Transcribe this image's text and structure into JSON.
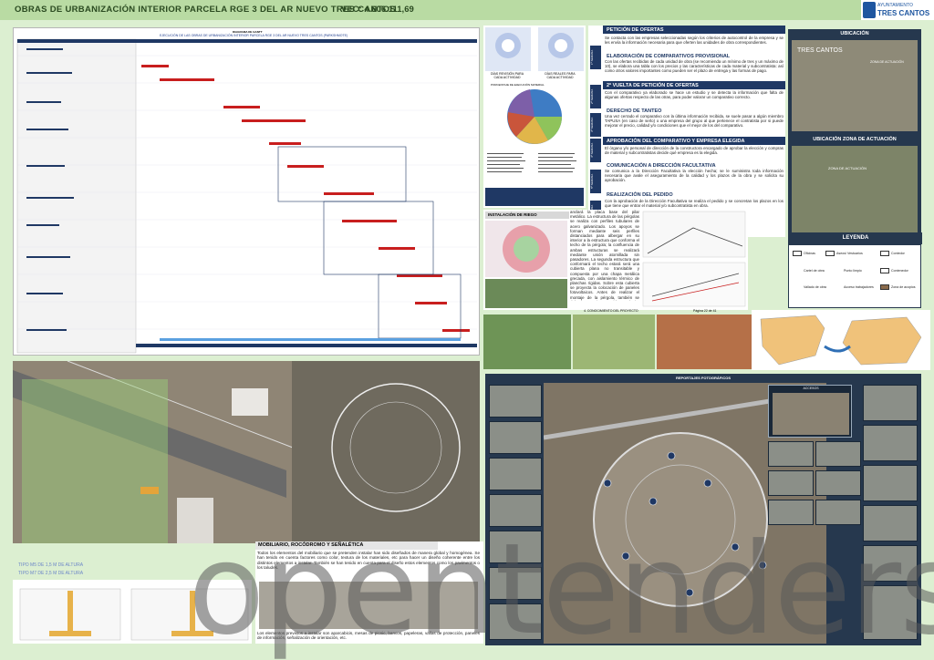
{
  "header": {
    "title": "OBRAS DE URBANIZACIÓN INTERIOR PARCELA RGE 3 DEL AR NUEVO TRES CANTOS",
    "version": "VEC: 4.606.111,69",
    "logo_line1": "AYUNTAMIENTO",
    "logo_line2": "TRES CANTOS"
  },
  "gantt": {
    "title_small": "DIAGRAMA DE GANTT",
    "title": "EJECUCIÓN DE LAS OBRAS DE URBANIZACIÓN INTERIOR PARCELA RGE 3 DEL AR NUEVO TRES CANTOS (PARKSHMOTE)"
  },
  "middle": {
    "caption1": "DÍAS REVISIÓN PARA CADA ACTIVIDAD",
    "caption2": "DÍAS REALES PARA CADA ACTIVIDAD",
    "pie_title": "PORCENTAJE DE EJECUCIÓN MATERIAL"
  },
  "steps": [
    {
      "title": "PETICIÓN DE OFERTAS",
      "side": "1ª SEMANA",
      "text": "Se contacta con las empresas seleccionadas según los criterios de autocontrol de la empresa y se les envía la información necesaria para que oferten las unidades de obra correspondientes."
    },
    {
      "title": "ELABORACIÓN DE COMPARATIVOS PROVISIONAL",
      "side": "",
      "text": "Con las ofertas recibidas de cada unidad de obra (se recomienda un mínimo de tres y un máximo de 10), se elabora una tabla con los precios y las características de cada material y subcontratista: así como otros valores importantes como pueden ser el plazo de entrega y las formas de pago."
    },
    {
      "title": "2ª VUELTA DE PETICIÓN DE OFERTAS",
      "side": "2ª SEMANA",
      "text": "Con el comparativo ya elaborado se hace un estudio y se detecta la información que falta de algunas ofertas respecto de las otras, para poder valorar un comparativo correcto."
    },
    {
      "title": "DERECHO DE TANTEO",
      "side": "3ª SEMANA",
      "text": "Una vez cerrado el comparativo con la última información recibida, se suele pasar a algún miembro TAPUSA (en caso de serlo) o una empresa del grupo al que pertenece el contratista por si puede mejorar el precio, calidad y/o condiciones que el mejor de los del comparativo."
    },
    {
      "title": "APROBACIÓN DEL COMPARATIVO Y EMPRESA ELEGIDA",
      "side": "4ª SEMANA",
      "text": "El órgano y/o personal de dirección de la constructora encargado de aprobar la elección y compras de material y subcontratistas decide qué empresa es la elegida."
    },
    {
      "title": "COMUNICACIÓN A DIRECCIÓN FACULTATIVA",
      "side": "5ª SEMANA",
      "text": "Se comunica a la Dirección Facultativa la elección hecha; se le suministra toda información necesaria que avale el aseguramiento de la calidad y los plazos de la obra y se solicita su aprobación."
    },
    {
      "title": "REALIZACIÓN DEL PEDIDO",
      "side": "6ª SEMANA",
      "text": "Con la aprobación de la Dirección Facultativa se realiza el pedido y se concretan los plazos en los que tiene que entrar el material y/o subcontratista en obra."
    }
  ],
  "riego": {
    "title": "INSTALACIÓN DE RIEGO",
    "text": "anclará la placa base del pilar metálico. La estructura de las pérgolas se realiza con perfiles tubulares de acero galvanizado. Los apoyos se forman mediante seis perfiles distanciados para albergar en su interior a la estructura que conforma el techo de la pérgola; la confluencia de ambas estructuras se realizará mediante unión atornillada sin pasadores. La segunda estructura que conformará el techo estará será una cubierta plana no transitable y compuesta por una chapa metálica grecada, con aislamiento térmico de planchas rígidas. Sobre esta cubierta se proyecta la colocación de paneles fotovoltaicos. Antes de realizar el montaje de la pérgola, también se deberá corregir con ruidos cualquier abolladura, torceduras o combas que haya aparecido durante las operaciones de transporte. Si el defecto no se puede corregir, o se presume que después de"
  },
  "pager": {
    "left": "4. CONOCIMIENTO DEL PROYECTO",
    "right": "Página 22 de 41"
  },
  "map_col": {
    "h1": "UBICACIÓN",
    "h2": "UBICACIÓN ZONA DE ACTUACIÓN",
    "label1": "TRES CANTOS",
    "label2": "ZONA DE ACTUACIÓN",
    "label3": "ZONA DE ACTUACIÓN"
  },
  "legend": {
    "title": "LEYENDA",
    "items": [
      "Oficinas",
      "Aseos/ Vestuarios",
      "Contedor",
      "Cartel de obra",
      "Punto limpio",
      "Contenedor",
      "Vallado de obra",
      "Acceso trabajadores",
      "Zona de acopios"
    ]
  },
  "mobiliario": {
    "title": "MOBILIARIO, ROCÓDROMO Y SEÑALÉTICA",
    "text1": "Todos los elementos del mobiliario que se pretenden instalar han sido diseñados de manera global y homogénea. Se han tenido en cuenta factores como color, textura de los materiales, etc para hacer un diseño coherente entre los distintos elementos a instalar. También se han tenido en cuenta para el diseño estos elementos como los pavimentos o los taludes.",
    "text2": "Los elementos previstos a instalar son aparcabicis, mesas de picnic, bancos, papeleras, vallas de protección, paneles de información, señalización de orientación, etc."
  },
  "tipos": [
    "TIPO M5 DE 1,5 M DE ALTURA",
    "TIPO M7 DE 2,5 M DE ALTURA"
  ],
  "reportaje": {
    "title": "REPORTAJES FOTOGRÁFICOS",
    "accesos": "ACCESOS"
  },
  "watermark": "opentenders",
  "colors": {
    "header": "#b9dba3",
    "navy": "#1f3864",
    "frame": "#dcefd1"
  }
}
